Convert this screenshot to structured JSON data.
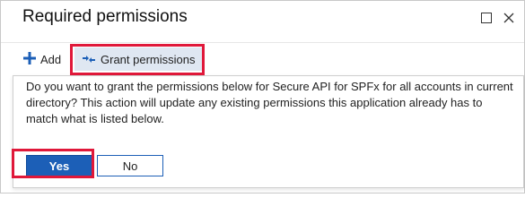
{
  "header": {
    "title": "Required permissions",
    "maximize_icon": "square-icon",
    "close_icon": "close-icon"
  },
  "toolbar": {
    "add_label": "Add",
    "add_icon": "plus-icon",
    "grant_label": "Grant permissions",
    "grant_icon": "key-icon"
  },
  "dialog": {
    "message": "Do you want to grant the permissions below for Secure API for SPFx for all accounts in current directory? This action will update any existing permissions this application already has to match what is listed below.",
    "yes_label": "Yes",
    "no_label": "No"
  },
  "colors": {
    "accent": "#1c5fb7",
    "highlight": "#e0183a",
    "selected_bg": "#dfe7f2"
  }
}
